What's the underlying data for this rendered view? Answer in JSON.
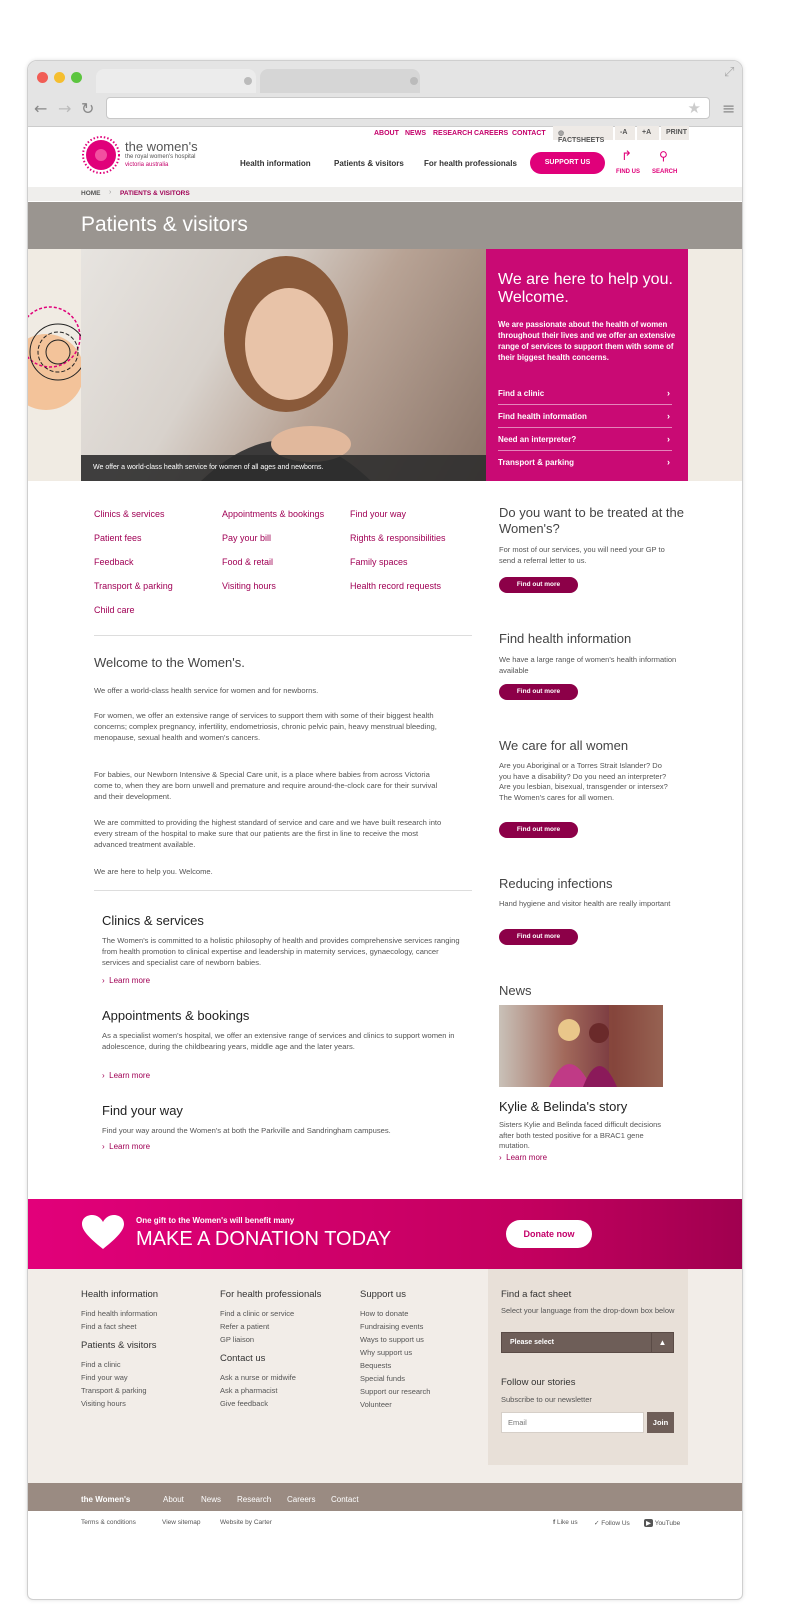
{
  "header": {
    "logo_title": "the women's",
    "logo_sub1": "the royal women's hospital",
    "logo_sub2": "victoria australia",
    "utility_links": [
      "ABOUT",
      "NEWS",
      "RESEARCH",
      "CAREERS",
      "CONTACT"
    ],
    "factsheets": "FACTSHEETS",
    "font_minus": "-A",
    "font_plus": "+A",
    "print": "PRINT",
    "nav": [
      "Health information",
      "Patients & visitors",
      "For health professionals"
    ],
    "support_button": "SUPPORT US",
    "find_us": "FIND US",
    "search": "SEARCH"
  },
  "breadcrumb": {
    "home": "HOME",
    "sep": "›",
    "current": "PATIENTS & VISITORS"
  },
  "page_title": "Patients & visitors",
  "hero": {
    "caption": "We offer a world-class health service for women of all ages and newborns.",
    "panel_title": "We are here to help you. Welcome.",
    "panel_text": "We are passionate about the health of women throughout their lives and we offer an extensive range of services to support them with some of their biggest health concerns.",
    "panel_links": [
      "Find a clinic",
      "Find health information",
      "Need an interpreter?",
      "Transport & parking"
    ]
  },
  "quick_links": [
    [
      "Clinics & services",
      "Patient fees",
      "Feedback",
      "Transport & parking",
      "Child care"
    ],
    [
      "Appointments & bookings",
      "Pay your bill",
      "Food & retail",
      "Visiting hours"
    ],
    [
      "Find your way",
      "Rights & responsibilities",
      "Family spaces",
      "Health record requests"
    ]
  ],
  "welcome": {
    "title": "Welcome to the Women's.",
    "paragraphs": [
      "We offer a world-class health service for women and for newborns.",
      "For women, we offer an extensive range of services to support them with some of their biggest health concerns; complex pregnancy, infertility, endometriosis, chronic pelvic pain, heavy menstrual bleeding, menopause, sexual health and women's cancers.",
      "For babies, our Newborn Intensive & Special Care unit, is a place where babies from across Victoria come to, when they are born unwell and premature and require around-the-clock care for their survival and their development.",
      "We are committed to providing the highest standard of service and care and we have built research into every stream of the hospital to make sure that our patients are the first in line to receive the most advanced treatment available.",
      "We are here to help you. Welcome."
    ]
  },
  "sections": [
    {
      "title": "Clinics & services",
      "text": "The Women's is committed to a holistic philosophy of health and provides comprehensive services ranging from health promotion to clinical expertise and leadership in maternity services, gynaecology, cancer services and specialist care of newborn babies.",
      "link": "Learn more"
    },
    {
      "title": "Appointments & bookings",
      "text": "As a specialist women's hospital, we offer an extensive range of services and clinics to support women in adolescence, during the childbearing years, middle age and the later years.",
      "link": "Learn more"
    },
    {
      "title": "Find your way",
      "text": "Find your way around the Women's at both the Parkville and Sandringham campuses.",
      "link": "Learn more"
    }
  ],
  "sidebar": [
    {
      "title": "Do you want to be treated at the Women's?",
      "text": "For most of our services, you will need your GP to send a referral letter to us.",
      "button": "Find out more"
    },
    {
      "title": "Find health information",
      "text": "We have a large range of women's health information available",
      "button": "Find out more"
    },
    {
      "title": "We care for all women",
      "text": "Are you Aboriginal or a Torres Strait Islander? Do you have a disability? Do you need an interpreter? Are you lesbian, bisexual, transgender or intersex? The Women's cares for all women.",
      "button": "Find out more"
    },
    {
      "title": "Reducing infections",
      "text": "Hand hygiene and visitor health are really important",
      "button": "Find out more"
    }
  ],
  "news": {
    "heading": "News",
    "story_title": "Kylie & Belinda's story",
    "story_text": "Sisters Kylie and Belinda faced difficult decisions after both tested positive for a BRAC1 gene mutation.",
    "link": "Learn more"
  },
  "donation": {
    "kicker": "One gift to the Women's will benefit many",
    "title": "MAKE A DONATION TODAY",
    "button": "Donate now"
  },
  "footer": {
    "col1": {
      "heading": "Health information",
      "links": [
        "Find health information",
        "Find a fact sheet"
      ],
      "heading2": "Patients & visitors",
      "links2": [
        "Find a clinic",
        "Find your way",
        "Transport & parking",
        "Visiting hours"
      ]
    },
    "col2": {
      "heading": "For health professionals",
      "links": [
        "Find a clinic or service",
        "Refer a patient",
        "GP liaison"
      ],
      "heading2": "Contact us",
      "links2": [
        "Ask a nurse or midwife",
        "Ask a pharmacist",
        "Give feedback"
      ]
    },
    "col3": {
      "heading": "Support us",
      "links": [
        "How to donate",
        "Fundraising events",
        "Ways to support us",
        "Why support us",
        "Bequests",
        "Special funds",
        "Support our research",
        "Volunteer"
      ]
    },
    "factsheet": {
      "heading": "Find a fact sheet",
      "text": "Select your language from the drop-down box below",
      "select": "Please select"
    },
    "follow": {
      "heading": "Follow our stories",
      "text": "Subscribe to our newsletter",
      "placeholder": "Email",
      "button": "Join"
    }
  },
  "bottom_bar": {
    "brand": "the Women's",
    "links": [
      "About",
      "News",
      "Research",
      "Careers",
      "Contact"
    ],
    "legal": [
      "Terms & conditions",
      "View sitemap",
      "Website by Carter"
    ],
    "social": [
      "Like us",
      "Follow Us",
      "YouTube"
    ]
  },
  "colors": {
    "magenta": "#c90a74",
    "dark_magenta": "#8c0048",
    "link": "#a00055",
    "grey_band": "#9a9590",
    "footer_bg": "#f2ede8",
    "bottom_bar": "#9a8b82"
  }
}
